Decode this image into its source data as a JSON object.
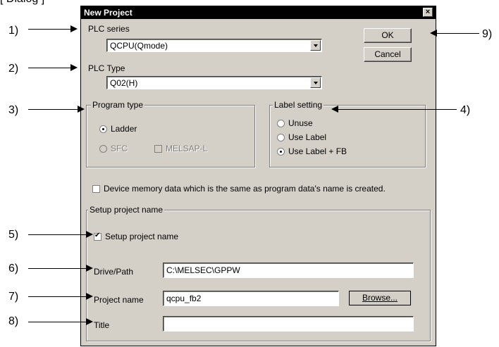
{
  "top_bracket": "[ Dialog ]",
  "callouts": [
    "1)",
    "2)",
    "3)",
    "4)",
    "5)",
    "6)",
    "7)",
    "8)",
    "9)"
  ],
  "dialog": {
    "title": "New Project",
    "close_glyph": "×",
    "plc_series_label": "PLC series",
    "plc_series_value": "QCPU(Qmode)",
    "plc_type_label": "PLC Type",
    "plc_type_value": "Q02(H)",
    "ok_label": "OK",
    "cancel_label": "Cancel",
    "program_type": {
      "title": "Program type",
      "ladder": "Ladder",
      "sfc": "SFC",
      "melsap": "MELSAP-L",
      "selected": "Ladder"
    },
    "label_setting": {
      "title": "Label setting",
      "unuse": "Unuse",
      "use_label": "Use Label",
      "use_label_fb": "Use Label + FB",
      "selected": "Use Label + FB"
    },
    "device_memory_text": "Device memory data which is the same as program data's name is created.",
    "device_memory_checked": false,
    "setup": {
      "title": "Setup project name",
      "checkbox_label": "Setup project name",
      "checked": true,
      "drive_path_label": "Drive/Path",
      "drive_path_value": "C:\\MELSEC\\GPPW",
      "project_name_label": "Project name",
      "project_name_value": "qcpu_fb2",
      "browse_label": "Browse...",
      "title_label": "Title",
      "title_value": ""
    }
  }
}
